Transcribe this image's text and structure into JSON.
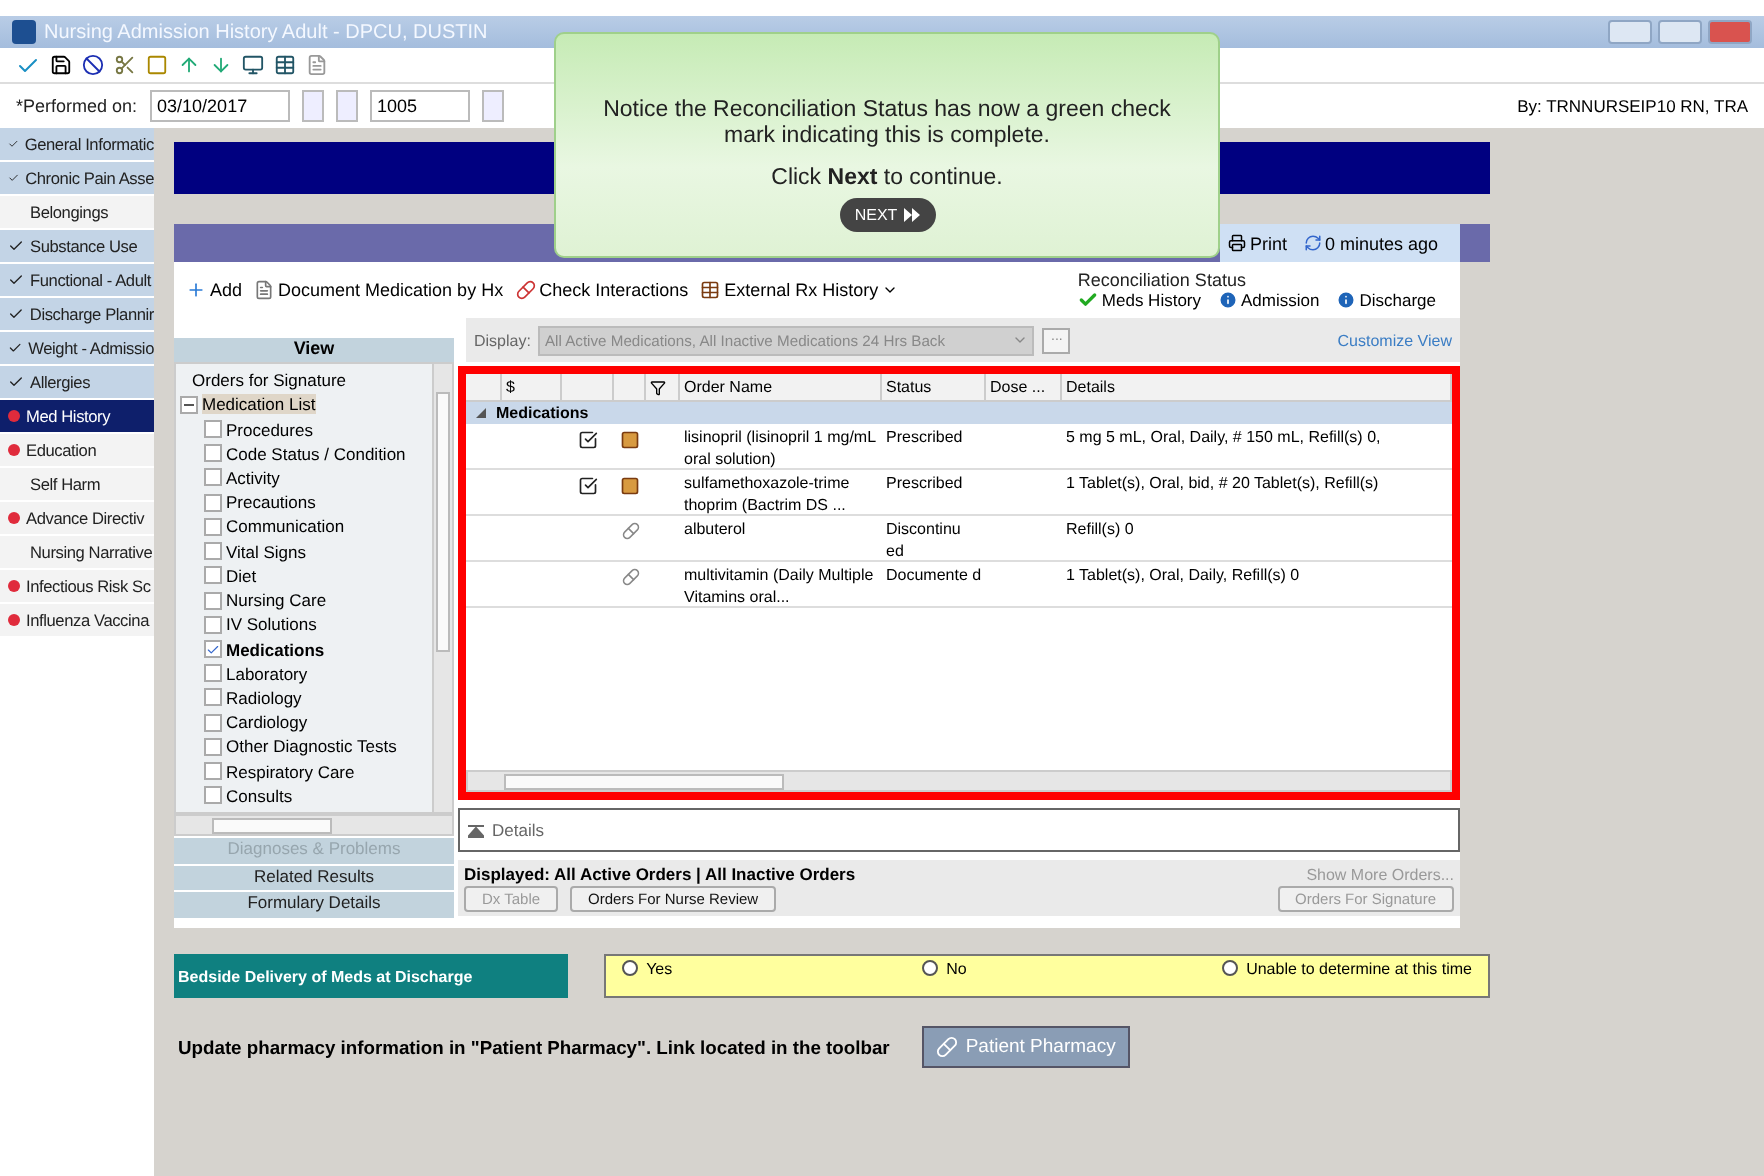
{
  "window": {
    "title": "Nursing Admission History Adult - DPCU, DUSTIN"
  },
  "performed": {
    "label": "*Performed on:",
    "date": "03/10/2017",
    "time": "1005",
    "by": "By:   TRNNURSEIP10 RN, TRA"
  },
  "sidebar": {
    "items": [
      {
        "label": "General Informatic",
        "kind": "complete",
        "selected": false
      },
      {
        "label": "Chronic Pain Asse",
        "kind": "complete",
        "selected": false
      },
      {
        "label": "Belongings",
        "kind": "plain",
        "selected": false
      },
      {
        "label": "Substance Use",
        "kind": "complete",
        "selected": false
      },
      {
        "label": "Functional - Adult",
        "kind": "complete",
        "selected": false
      },
      {
        "label": "Discharge Plannir",
        "kind": "complete",
        "selected": false
      },
      {
        "label": "Weight - Admissio",
        "kind": "complete",
        "selected": false
      },
      {
        "label": "Allergies",
        "kind": "complete",
        "selected": false
      },
      {
        "label": "Med History",
        "kind": "required",
        "selected": true
      },
      {
        "label": "Education",
        "kind": "required",
        "selected": false
      },
      {
        "label": "Self Harm",
        "kind": "plain",
        "selected": false
      },
      {
        "label": "Advance Directiv",
        "kind": "required",
        "selected": false
      },
      {
        "label": "Nursing Narrative",
        "kind": "plain",
        "selected": false
      },
      {
        "label": "Infectious Risk Sc",
        "kind": "required",
        "selected": false
      },
      {
        "label": "Influenza Vaccina",
        "kind": "required",
        "selected": false
      }
    ]
  },
  "callout": {
    "text": "Notice the Reconciliation Status has now a green check mark indicating this is complete.",
    "action": "Click **Next** to continue.",
    "button": "NEXT"
  },
  "header": {
    "print": "Print",
    "refresh": "0 minutes ago"
  },
  "med_toolbar": {
    "buttons": [
      {
        "label": "Add",
        "kind": "add"
      },
      {
        "label": "Document Medication by Hx",
        "kind": "document"
      },
      {
        "label": "Check Interactions",
        "kind": "interactions"
      },
      {
        "label": "External Rx History",
        "kind": "external"
      }
    ],
    "reconciliation": {
      "title": "Reconciliation Status",
      "items": [
        {
          "label": "Meds History",
          "kind": "complete"
        },
        {
          "label": "Admission",
          "kind": "pending"
        },
        {
          "label": "Discharge",
          "kind": "pending"
        }
      ]
    }
  },
  "view_panel": {
    "title": "View",
    "tree": [
      {
        "label": "Orders for Signature"
      },
      {
        "label": "Medication List",
        "expanded": true,
        "children": [
          {
            "label": "Procedures",
            "checked": false
          },
          {
            "label": "Code Status / Condition",
            "checked": false
          },
          {
            "label": "Activity",
            "checked": false
          },
          {
            "label": "Precautions",
            "checked": false
          },
          {
            "label": "Communication",
            "checked": false
          },
          {
            "label": "Vital Signs",
            "checked": false
          },
          {
            "label": "Diet",
            "checked": false
          },
          {
            "label": "Nursing Care",
            "checked": false
          },
          {
            "label": "IV Solutions",
            "checked": false
          },
          {
            "label": "Medications",
            "checked": true
          },
          {
            "label": "Laboratory",
            "checked": false
          },
          {
            "label": "Radiology",
            "checked": false
          },
          {
            "label": "Cardiology",
            "checked": false
          },
          {
            "label": "Other Diagnostic Tests",
            "checked": false
          },
          {
            "label": "Respiratory Care",
            "checked": false
          },
          {
            "label": "Consults",
            "checked": false
          }
        ]
      }
    ],
    "sections": [
      {
        "label": "Diagnoses & Problems",
        "disabled": true
      },
      {
        "label": "Related Results",
        "disabled": false
      },
      {
        "label": "Formulary Details",
        "disabled": false
      }
    ]
  },
  "display": {
    "label": "Display:",
    "value": "All Active Medications, All Inactive Medications 24 Hrs Back",
    "more": "...",
    "customize": "Customize View"
  },
  "table": {
    "columns": [
      "$",
      "Order Name",
      "Status",
      "Dose ...",
      "Details"
    ],
    "group": {
      "label": "Medications",
      "expanded": true
    },
    "rows": [
      {
        "kind": "prescription",
        "checked": true,
        "name": "lisinopril (lisinopril 1 mg/mL oral solution)",
        "status": "Prescribed",
        "details": "5 mg 5 mL, Oral, Daily, # 150 mL, Refill(s) 0,"
      },
      {
        "kind": "prescription",
        "checked": true,
        "name": "sulfamethoxazole-trime thoprim (Bactrim DS ...",
        "status": "Prescribed",
        "details": "1 Tablet(s), Oral, bid, # 20 Tablet(s), Refill(s)"
      },
      {
        "kind": "documented",
        "name": "albuterol",
        "status": "Discontinu ed",
        "details": "Refill(s) 0"
      },
      {
        "kind": "documented",
        "name": "multivitamin (Daily Multiple Vitamins oral...",
        "status": "Documente d",
        "details": "1 Tablet(s), Oral, Daily, Refill(s) 0"
      }
    ]
  },
  "details_panel": {
    "label": "Details"
  },
  "footer": {
    "displayed": "Displayed: All Active Orders  |  All Inactive Orders",
    "show_more": "Show More Orders...",
    "buttons": [
      {
        "label": "Dx Table",
        "disabled": true
      },
      {
        "label": "Orders For Nurse Review",
        "disabled": false
      }
    ],
    "sign": {
      "label": "Orders For Signature",
      "disabled": true
    }
  },
  "bedside": {
    "label": "Bedside Delivery of Meds at Discharge",
    "options": [
      {
        "label": "Yes",
        "selected": false
      },
      {
        "label": "No",
        "selected": false
      },
      {
        "label": "Unable to determine at this time",
        "selected": false
      }
    ]
  },
  "pharmacy": {
    "text": "Update pharmacy information in \"Patient Pharmacy\". Link located in the toolbar",
    "button": "Patient Pharmacy"
  }
}
